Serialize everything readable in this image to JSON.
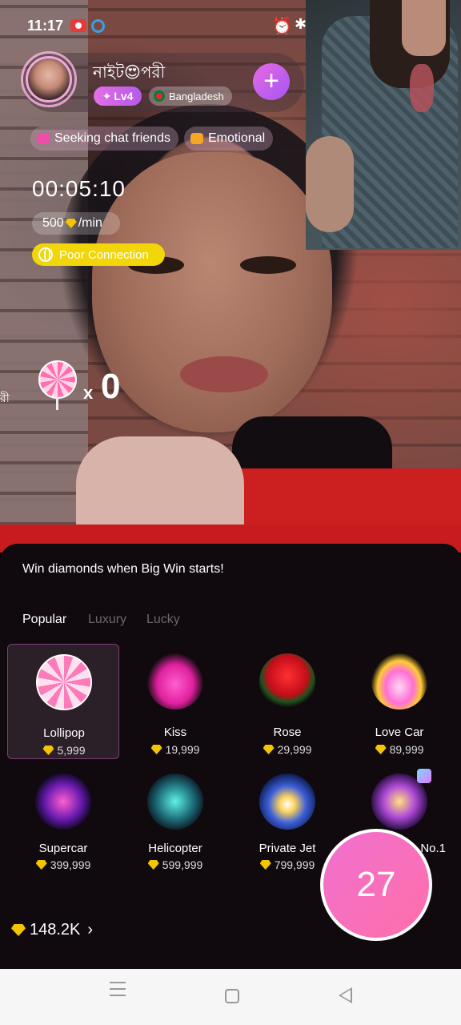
{
  "status_bar": {
    "time": "11:17"
  },
  "profile": {
    "name": "নাইট😍পরী",
    "level": "Lv4",
    "country": "Bangladesh",
    "follow_icon": "plus-icon"
  },
  "tags": [
    {
      "label": "Seeking chat friends",
      "color": "#f04da8"
    },
    {
      "label": "Emotional",
      "color": "#f5a623"
    }
  ],
  "call": {
    "timer": "00:05:10",
    "rate_amount": "500",
    "rate_unit": "/min",
    "connection_status": "Poor Connection"
  },
  "lollipop_counter": {
    "x": "x",
    "count": "0"
  },
  "side_text": "রী",
  "panel": {
    "title": "Win diamonds when Big Win starts!",
    "tabs": [
      "Popular",
      "Luxury",
      "Lucky"
    ],
    "active_tab": "Popular",
    "gifts": [
      {
        "name": "Lollipop",
        "price": "5,999"
      },
      {
        "name": "Kiss",
        "price": "19,999"
      },
      {
        "name": "Rose",
        "price": "29,999"
      },
      {
        "name": "Love Car",
        "price": "89,999"
      },
      {
        "name": "Supercar",
        "price": "399,999"
      },
      {
        "name": "Helicopter",
        "price": "599,999"
      },
      {
        "name": "Private Jet",
        "price": "799,999"
      },
      {
        "name": "No.1",
        "price": ""
      }
    ],
    "balance": "148.2K",
    "send_count": "27"
  },
  "colors": {
    "accent": "#e86ae8",
    "diamond": "#f5c400",
    "connection": "#f2d60a"
  }
}
